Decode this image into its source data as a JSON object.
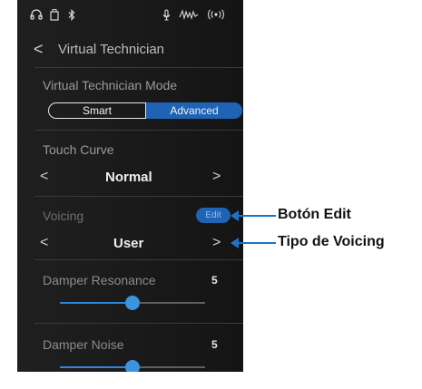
{
  "statusbar": {
    "icons": [
      {
        "name": "headphones-icon",
        "glyph": "🎧"
      },
      {
        "name": "usb-storage-icon",
        "glyph": "▯"
      },
      {
        "name": "bluetooth-icon",
        "glyph": "ᛒ"
      },
      {
        "name": "microphone-icon",
        "glyph": "🎙"
      },
      {
        "name": "audio-waveform-icon",
        "glyph": "〰"
      },
      {
        "name": "wireless-icon",
        "glyph": "((·))"
      }
    ]
  },
  "header": {
    "back_glyph": "<",
    "title": "Virtual Technician"
  },
  "mode": {
    "label": "Virtual Technician Mode",
    "options": [
      "Smart",
      "Advanced"
    ],
    "selected": "Advanced"
  },
  "touch_curve": {
    "label": "Touch Curve",
    "value": "Normal",
    "prev": "<",
    "next": ">"
  },
  "voicing": {
    "label": "Voicing",
    "edit_label": "Edit",
    "value": "User",
    "prev": "<",
    "next": ">"
  },
  "damper_resonance": {
    "label": "Damper Resonance",
    "value": "5",
    "level": 0.5
  },
  "damper_noise": {
    "label": "Damper Noise",
    "value": "5",
    "level": 0.5
  },
  "callouts": {
    "edit_button": "Botón Edit",
    "voicing_type": "Tipo de Voicing"
  },
  "colors": {
    "accent": "#1e63b4",
    "callout": "#1e73c8",
    "background": "#1b1b1b"
  }
}
